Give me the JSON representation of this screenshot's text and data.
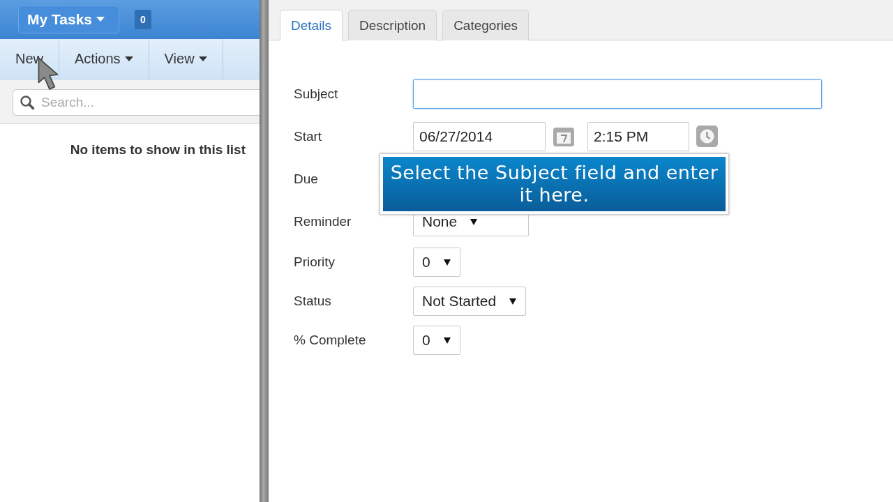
{
  "sidebar": {
    "view_button": "My Tasks",
    "count": "0",
    "toolbar": [
      {
        "label": "New",
        "has_menu": false
      },
      {
        "label": "Actions",
        "has_menu": true
      },
      {
        "label": "View",
        "has_menu": true
      }
    ],
    "search": {
      "placeholder": "Search..."
    },
    "empty_message": "No items to show in this list"
  },
  "tabs": [
    {
      "label": "Details",
      "selected": true
    },
    {
      "label": "Description",
      "selected": false
    },
    {
      "label": "Categories",
      "selected": false
    }
  ],
  "form": {
    "fields": [
      {
        "label": "Subject",
        "kind": "text",
        "focused": true
      },
      {
        "label": "Start",
        "kind": "datetime",
        "date": "06/27/2014",
        "time": "2:15 PM"
      },
      {
        "label": "Due",
        "kind": "datetime"
      },
      {
        "label": "Reminder",
        "kind": "select",
        "value": "None"
      },
      {
        "label": "Priority",
        "kind": "select",
        "value": "0"
      },
      {
        "label": "Status",
        "kind": "select",
        "value": "Not Started"
      },
      {
        "label": "% Complete",
        "kind": "select",
        "value": "0"
      }
    ]
  },
  "callout": {
    "text": "Select the Subject field and enter it here."
  }
}
